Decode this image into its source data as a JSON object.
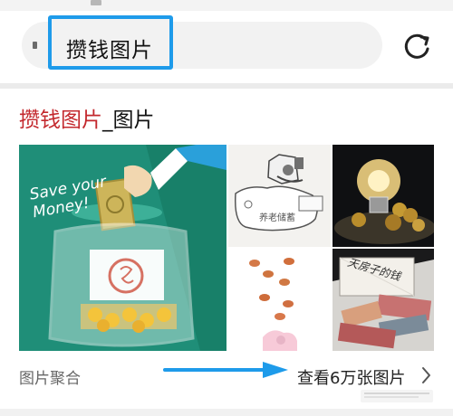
{
  "search": {
    "query": "攒钱图片"
  },
  "section": {
    "title_highlight": "攒钱图片",
    "title_suffix": "_图片"
  },
  "tiles": {
    "main_text": "Save your Money!",
    "piggy_label": "养老储蓄",
    "money_label": "天房子的钱"
  },
  "footer": {
    "left_label": "图片聚合",
    "right_label": "查看6万张图片"
  },
  "colors": {
    "highlight": "#c3282d",
    "annotation": "#1e9bea",
    "teal": "#1d8a75"
  },
  "icons": {
    "refresh": "refresh-icon",
    "chevron": "chevron-right-icon"
  }
}
